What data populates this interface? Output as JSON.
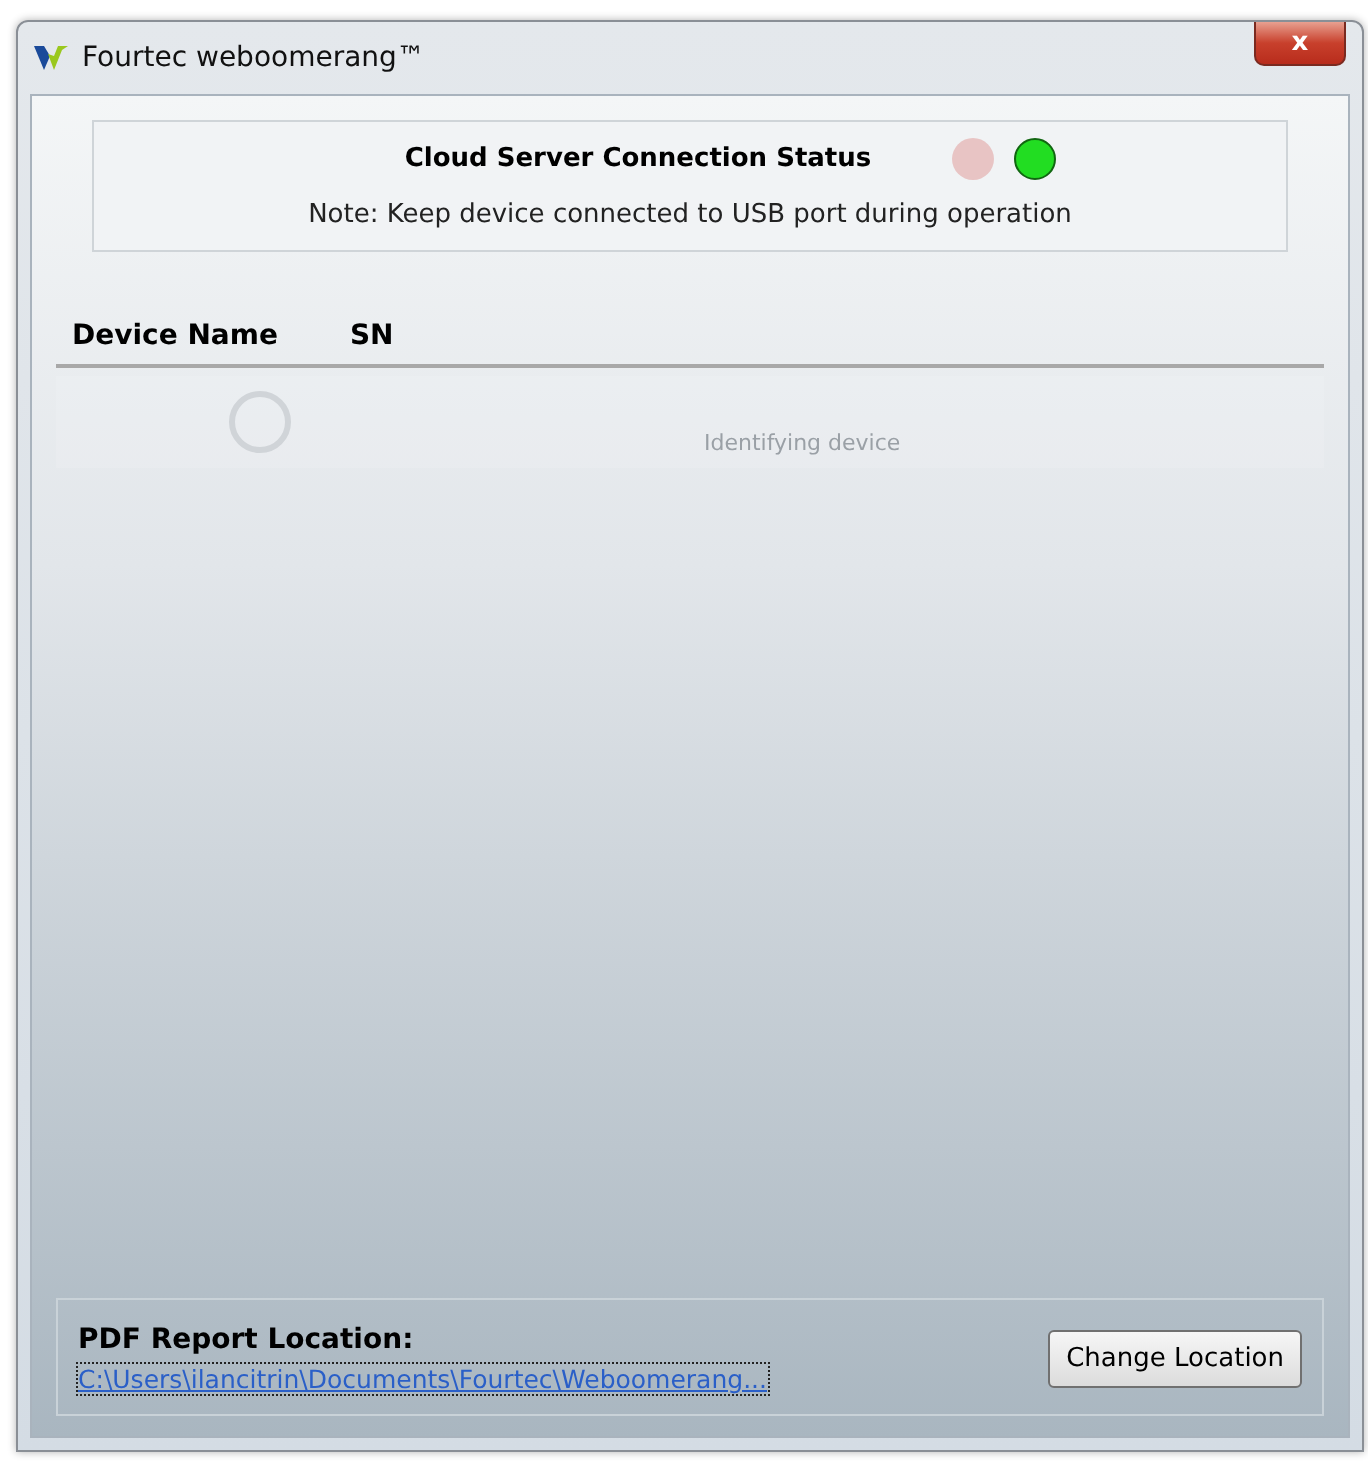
{
  "window": {
    "title": "Fourtec weboomerang™",
    "close": "x"
  },
  "status": {
    "title": "Cloud Server Connection Status",
    "lights": [
      {
        "color": "#e8c4c4",
        "on": false
      },
      {
        "color": "#22dd22",
        "on": true
      }
    ],
    "note": "Note: Keep device connected to USB port during operation"
  },
  "table": {
    "columns": [
      "Device Name",
      "SN"
    ],
    "loading_text": "Identifying device"
  },
  "report": {
    "label": "PDF Report Location:",
    "path": "C:\\Users\\ilancitrin\\Documents\\Fourtec\\Weboomerang...",
    "button": "Change Location"
  }
}
